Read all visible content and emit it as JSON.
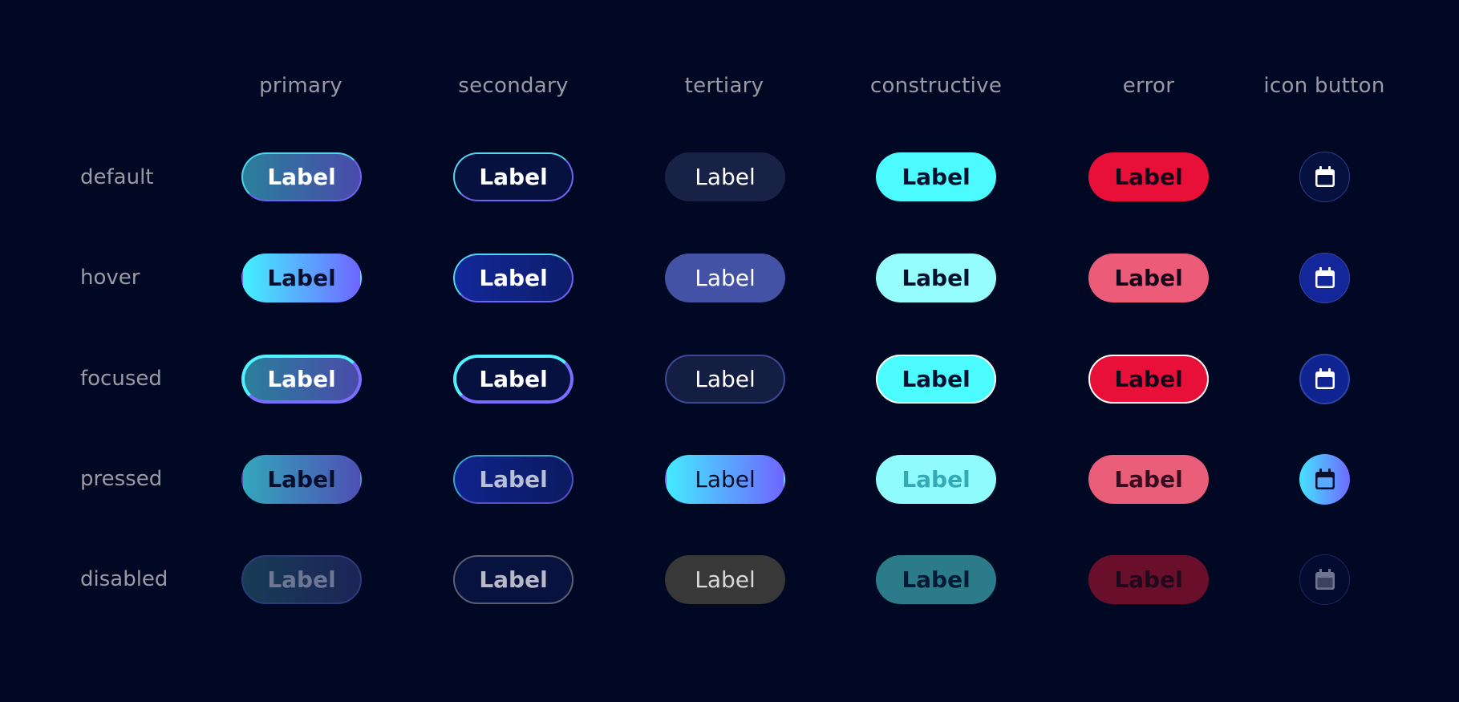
{
  "columns": [
    "primary",
    "secondary",
    "tertiary",
    "constructive",
    "error",
    "icon button"
  ],
  "rows": [
    "default",
    "hover",
    "focused",
    "pressed",
    "disabled"
  ],
  "button_label": "Label",
  "icon": "calendar-icon",
  "colors": {
    "background": "#000823",
    "primary_gradient": [
      "#44f0ff",
      "#6e66ff"
    ],
    "constructive": "#4bfbfd",
    "error": "#e81038",
    "tertiary": "#182247"
  }
}
